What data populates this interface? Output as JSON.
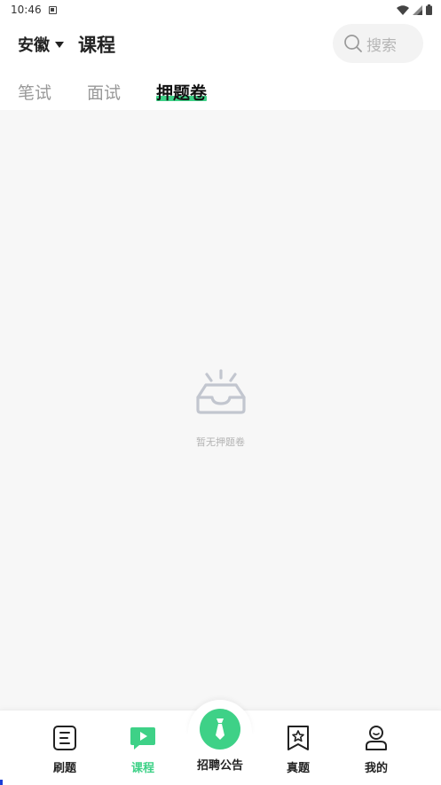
{
  "status_bar": {
    "time": "10:46"
  },
  "header": {
    "region": "安徽",
    "title": "课程",
    "search_placeholder": "搜索"
  },
  "tabs": [
    {
      "label": "笔试",
      "active": false
    },
    {
      "label": "面试",
      "active": false
    },
    {
      "label": "押题卷",
      "active": true
    }
  ],
  "empty_state": {
    "text": "暂无押题卷"
  },
  "bottom_nav": {
    "items": [
      {
        "label": "刷题",
        "active": false,
        "icon": "document-icon"
      },
      {
        "label": "课程",
        "active": true,
        "icon": "video-play-icon"
      },
      {
        "label": "招聘公告",
        "active": false,
        "icon": "tie-icon"
      },
      {
        "label": "真题",
        "active": false,
        "icon": "star-bookmark-icon"
      },
      {
        "label": "我的",
        "active": false,
        "icon": "user-icon"
      }
    ]
  },
  "colors": {
    "accent": "#3ed187",
    "background": "#f7f7f7",
    "icon_gray": "#c2c6cf"
  }
}
